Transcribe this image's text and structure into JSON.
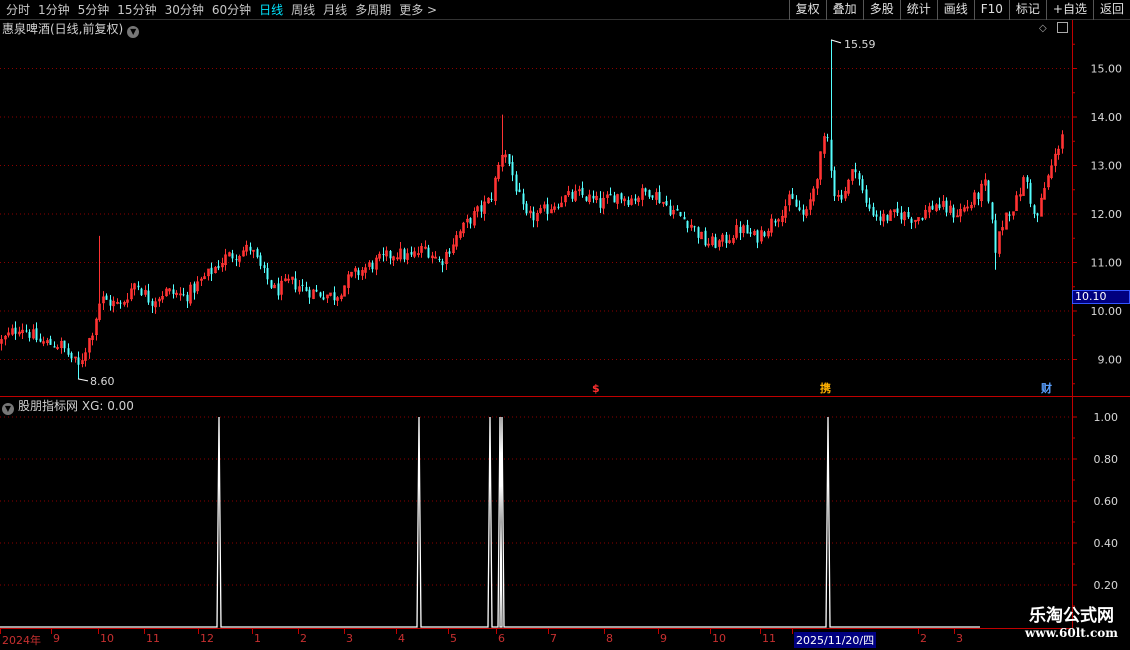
{
  "toolbar": {
    "periods": [
      {
        "label": "分时",
        "active": false
      },
      {
        "label": "1分钟",
        "active": false
      },
      {
        "label": "5分钟",
        "active": false
      },
      {
        "label": "15分钟",
        "active": false
      },
      {
        "label": "30分钟",
        "active": false
      },
      {
        "label": "60分钟",
        "active": false
      },
      {
        "label": "日线",
        "active": true
      },
      {
        "label": "周线",
        "active": false
      },
      {
        "label": "月线",
        "active": false
      },
      {
        "label": "多周期",
        "active": false
      },
      {
        "label": "更多 >",
        "active": false
      }
    ],
    "right_tools": [
      "复权",
      "叠加",
      "多股",
      "统计",
      "画线",
      "F10",
      "标记",
      "+自选",
      "返回"
    ]
  },
  "main_chart": {
    "title": "惠泉啤酒(日线,前复权)",
    "y_labels": [
      "15.00",
      "14.00",
      "13.00",
      "12.00",
      "11.00",
      "10.00",
      "9.00"
    ],
    "high_label": "15.59",
    "low_label": "8.60",
    "current_price": "10.10",
    "markers": [
      {
        "text": "$",
        "color": "#ff3030"
      },
      {
        "text": "携",
        "color": "#ffb000"
      },
      {
        "text": "财",
        "color": "#5aa0ff"
      }
    ]
  },
  "indicator": {
    "title": "股朋指标网",
    "value": "XG: 0.00",
    "y_labels": [
      "1.00",
      "0.80",
      "0.60",
      "0.40",
      "0.20"
    ]
  },
  "date_axis": {
    "labels": [
      {
        "text": "2024年",
        "hl": false
      },
      {
        "text": "9",
        "hl": false
      },
      {
        "text": "10",
        "hl": false
      },
      {
        "text": "11",
        "hl": false
      },
      {
        "text": "12",
        "hl": false
      },
      {
        "text": "1",
        "hl": false
      },
      {
        "text": "2",
        "hl": false
      },
      {
        "text": "3",
        "hl": false
      },
      {
        "text": "4",
        "hl": false
      },
      {
        "text": "5",
        "hl": false
      },
      {
        "text": "6",
        "hl": false
      },
      {
        "text": "7",
        "hl": false
      },
      {
        "text": "8",
        "hl": false
      },
      {
        "text": "9",
        "hl": false
      },
      {
        "text": "10",
        "hl": false
      },
      {
        "text": "11",
        "hl": false
      },
      {
        "text": "2025/11/20/四",
        "hl": true
      },
      {
        "text": "2",
        "hl": false
      },
      {
        "text": "3",
        "hl": false
      }
    ]
  },
  "watermark": {
    "title": "乐淘公式网",
    "url": "www.60lt.com"
  },
  "colors": {
    "up": "#ff3333",
    "down": "#54ffff",
    "grid": "#8b0000",
    "axis": "#c00000"
  }
}
